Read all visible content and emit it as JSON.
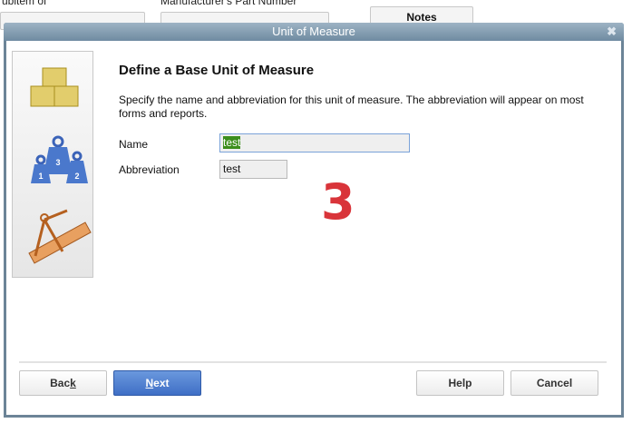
{
  "background": {
    "subitem_label": "ubitem of",
    "mpn_label": "Manufacturer's Part Number",
    "notes_button": "Notes"
  },
  "dialog": {
    "title": "Unit of Measure",
    "heading": "Define a Base Unit of Measure",
    "description": "Specify the name and abbreviation for this unit of measure. The abbreviation will appear on most forms and reports.",
    "name_label": "Name",
    "name_value": "test",
    "abbreviation_label": "Abbreviation",
    "abbreviation_value": "test",
    "step_marker": "3",
    "weights_numbers": [
      "1",
      "3",
      "2"
    ],
    "buttons": {
      "back_pre": "Bac",
      "back_key": "k",
      "next_key": "N",
      "next_post": "ext",
      "help": "Help",
      "cancel": "Cancel"
    }
  }
}
